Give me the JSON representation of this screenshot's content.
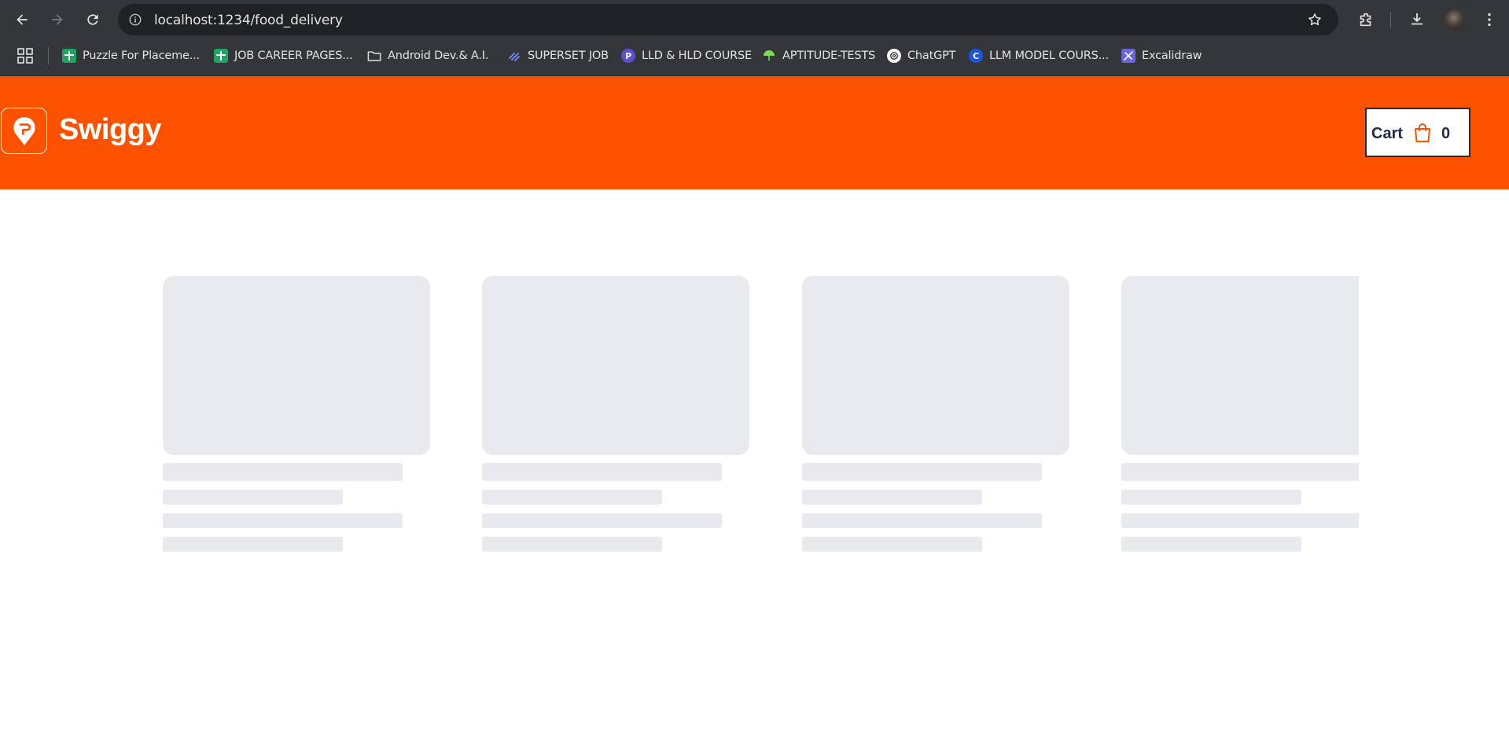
{
  "browser": {
    "url": "localhost:1234/food_delivery",
    "bookmarks": [
      {
        "label": "Puzzle For Placeme...",
        "icon": "sheets-icon",
        "color": "#1fa463"
      },
      {
        "label": "JOB  CAREER PAGES...",
        "icon": "sheets-icon",
        "color": "#1fa463"
      },
      {
        "label": "Android Dev.& A.I.",
        "icon": "folder-icon",
        "color": "#e3e3e3"
      },
      {
        "label": "SUPERSET JOB",
        "icon": "superset-icon",
        "color": "#5b6cff"
      },
      {
        "label": "LLD & HLD COURSE",
        "icon": "course-icon",
        "color": "#6a5acd"
      },
      {
        "label": "APTITUDE-TESTS",
        "icon": "umbrella-icon",
        "color": "#7ed957"
      },
      {
        "label": "ChatGPT",
        "icon": "chatgpt-icon",
        "color": "#ffffff"
      },
      {
        "label": "LLM MODEL COURS...",
        "icon": "c-icon",
        "color": "#1a56db"
      },
      {
        "label": "Excalidraw",
        "icon": "excalidraw-icon",
        "color": "#6965db"
      }
    ]
  },
  "header": {
    "brand": "Swiggy",
    "brand_color": "#fc5200",
    "cart_label": "Cart",
    "cart_count": "0"
  },
  "skeleton": {
    "placeholder_color": "#e9eaed",
    "card_count": 4
  }
}
